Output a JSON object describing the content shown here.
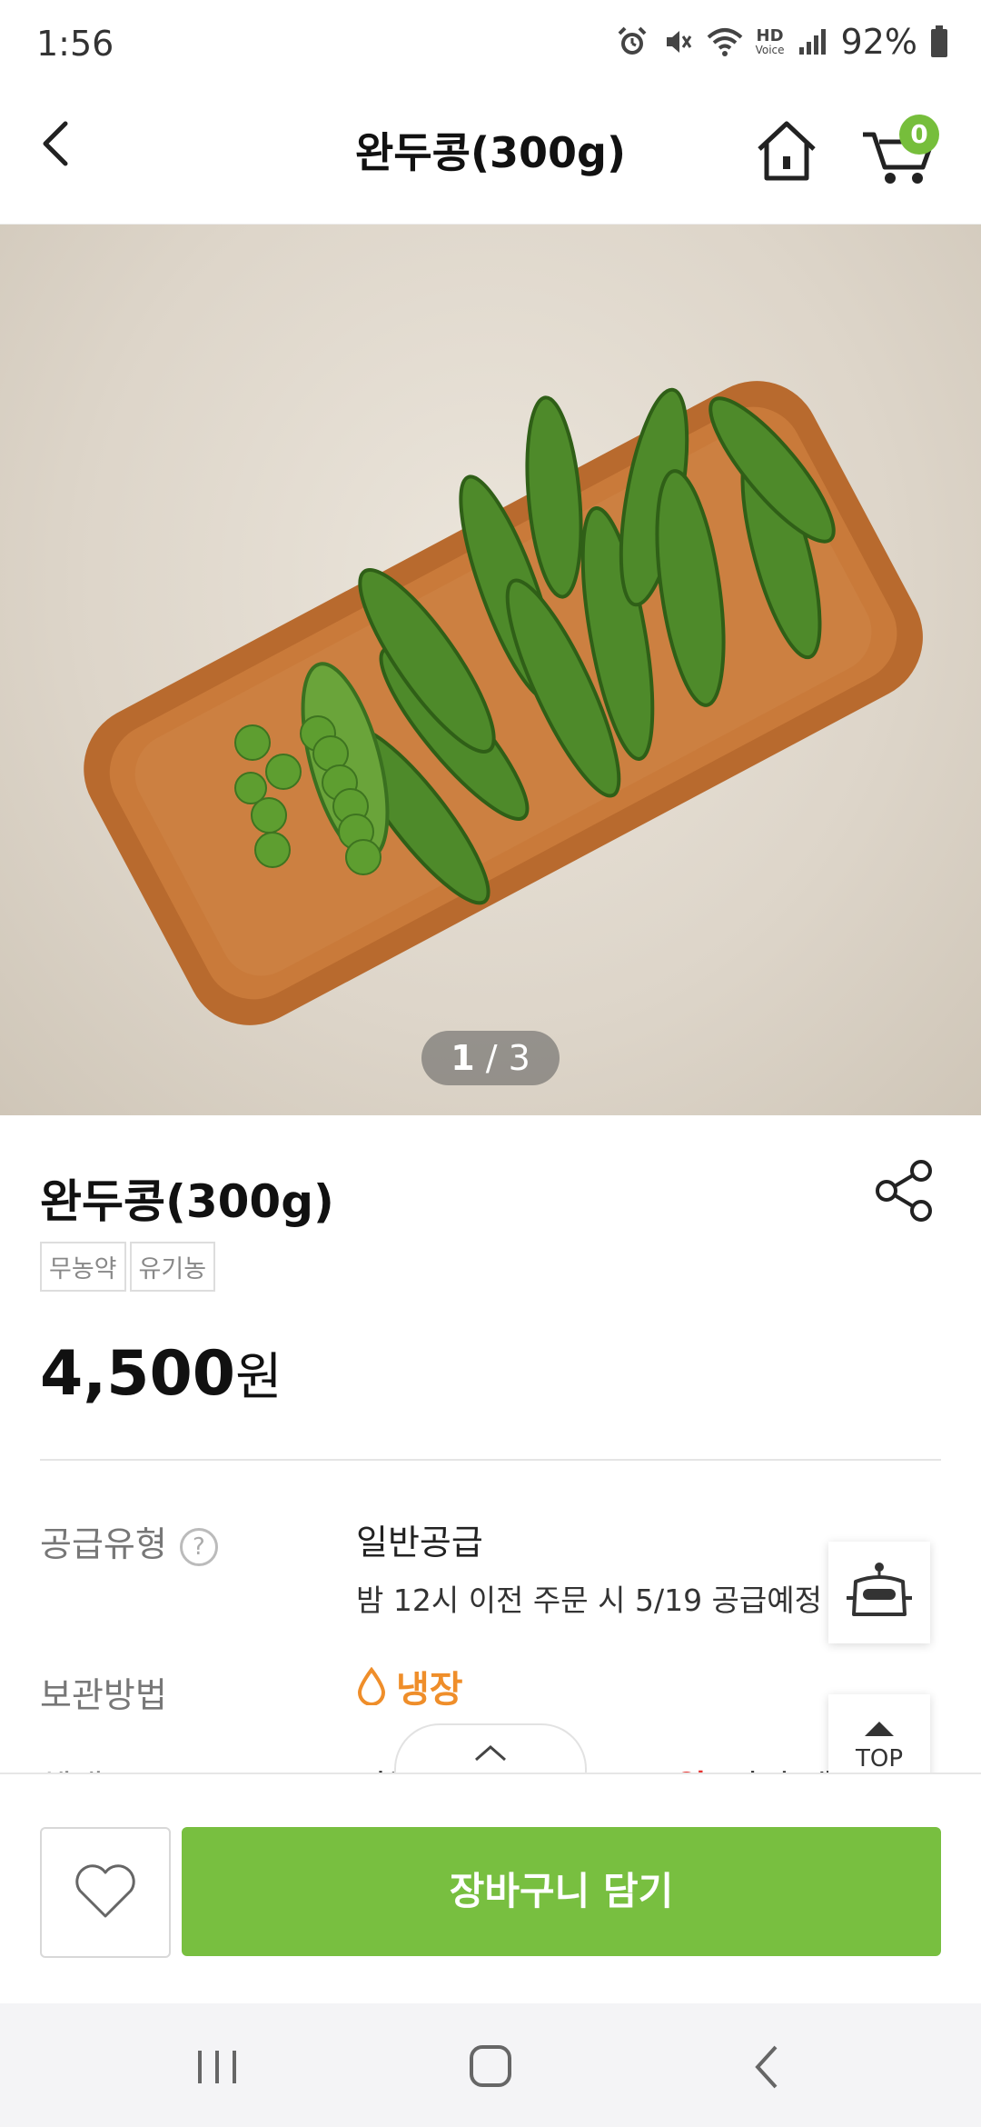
{
  "status_bar": {
    "time": "1:56",
    "battery_text": "92%",
    "hd_label_top": "HD",
    "hd_label_bottom": "Voice"
  },
  "header": {
    "title": "완두콩(300g)",
    "cart_count": "0"
  },
  "gallery": {
    "current": "1",
    "separator": " / ",
    "total": "3"
  },
  "product": {
    "name": "완두콩(300g)",
    "tags": [
      "무농약",
      "유기농"
    ],
    "price": "4,500",
    "currency": "원"
  },
  "info": {
    "supply_label": "공급유형",
    "help_symbol": "?",
    "supply_value": "일반공급",
    "supply_note": "밤 12시 이전 주문 시 5/19 공급예정",
    "storage_label": "보관방법",
    "storage_value": "냉장"
  },
  "floating": {
    "top_label": "TOP"
  },
  "bottom_bar": {
    "add_to_cart_label": "장바구니 담기"
  },
  "colors": {
    "accent_green": "#78bf40",
    "storage_orange": "#ef8e2a",
    "badge_green": "#76be3b"
  }
}
